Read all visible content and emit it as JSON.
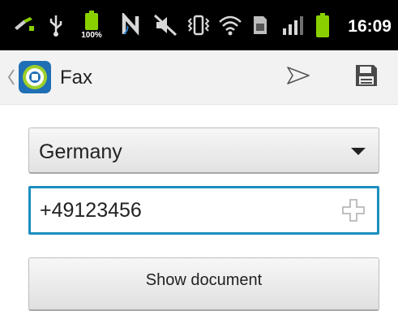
{
  "status_bar": {
    "time": "16:09",
    "battery_small_label": "100%",
    "icons": [
      "usb-debug-icon",
      "usb-icon",
      "battery-small-icon",
      "nfc-icon",
      "mute-icon",
      "vibrate-icon",
      "wifi-icon",
      "sim-icon",
      "signal-icon",
      "battery-icon"
    ]
  },
  "action_bar": {
    "title": "Fax",
    "actions": [
      "send-icon",
      "save-icon"
    ]
  },
  "form": {
    "country": "Germany",
    "fax_number": "+49123456",
    "show_document_label": "Show document"
  },
  "colors": {
    "accent": "#1b8fbf",
    "battery_green": "#8ad000",
    "status_bg": "#000000"
  }
}
